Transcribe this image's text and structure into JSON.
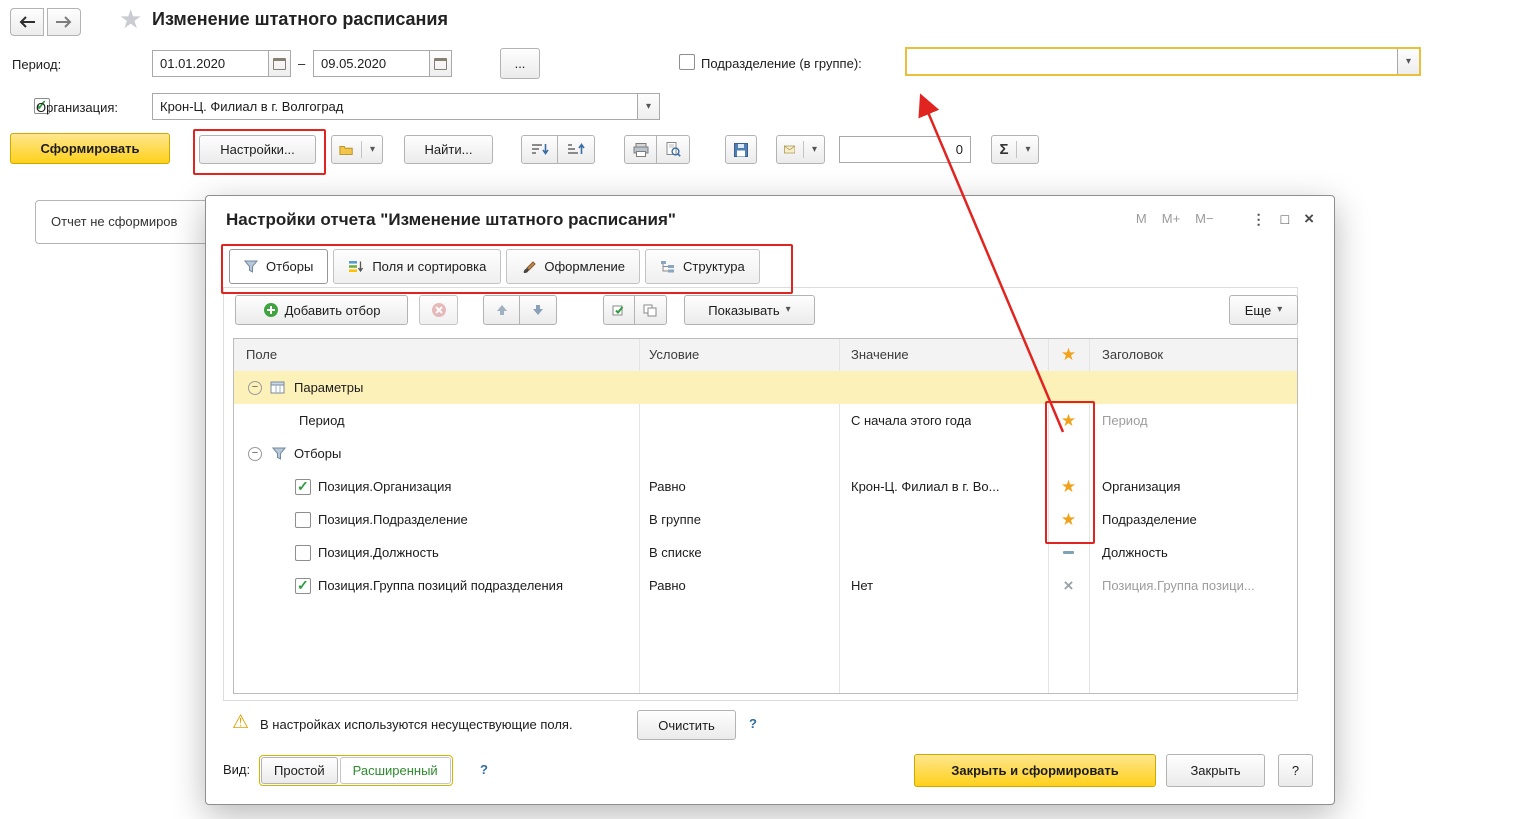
{
  "topbar": {
    "title": "Изменение штатного расписания"
  },
  "filters": {
    "period_label": "Период:",
    "date_from": "01.01.2020",
    "date_to": "09.05.2020",
    "range_dash": "–",
    "ellipsis": "...",
    "department_label": "Подразделение (в группе):",
    "department_value": "",
    "department_checked": false,
    "org_label": "Организация:",
    "org_value": "Крон-Ц. Филиал в г. Волгоград",
    "org_checked": true
  },
  "toolbar": {
    "generate": "Сформировать",
    "settings": "Настройки...",
    "find": "Найти...",
    "count_value": "0",
    "sigma": "Σ"
  },
  "report_area": {
    "status_tab": "Отчет не сформиров"
  },
  "dialog": {
    "title": "Настройки отчета \"Изменение штатного расписания\"",
    "controls": {
      "m": "M",
      "m_plus": "M+",
      "m_minus": "M−"
    },
    "tabs": [
      {
        "label": "Отборы"
      },
      {
        "label": "Поля и сортировка"
      },
      {
        "label": "Оформление"
      },
      {
        "label": "Структура"
      }
    ],
    "toolbar": {
      "add": "Добавить отбор",
      "show": "Показывать",
      "more": "Еще"
    },
    "table": {
      "headers": {
        "field": "Поле",
        "condition": "Условие",
        "value": "Значение",
        "star": "star",
        "title": "Заголовок"
      },
      "rows": [
        {
          "kind": "group",
          "label": "Параметры",
          "selected": true
        },
        {
          "kind": "param",
          "field": "Период",
          "condition": "",
          "value": "С начала этого года",
          "marker": "star",
          "title": "Период"
        },
        {
          "kind": "group",
          "label": "Отборы"
        },
        {
          "kind": "filter",
          "checked": true,
          "field": "Позиция.Организация",
          "condition": "Равно",
          "value": "Крон-Ц. Филиал в г. Во...",
          "marker": "star",
          "title": "Организация"
        },
        {
          "kind": "filter",
          "checked": false,
          "field": "Позиция.Подразделение",
          "condition": "В группе",
          "value": "",
          "marker": "star",
          "title": "Подразделение"
        },
        {
          "kind": "filter",
          "checked": false,
          "field": "Позиция.Должность",
          "condition": "В списке",
          "value": "",
          "marker": "dash",
          "title": "Должность"
        },
        {
          "kind": "filter",
          "checked": true,
          "field": "Позиция.Группа позиций подразделения",
          "condition": "Равно",
          "value": "Нет",
          "marker": "x",
          "title": "Позиция.Группа позици..."
        }
      ]
    },
    "warning": {
      "text": "В настройках используются несуществующие поля.",
      "clear": "Очистить",
      "help": "?"
    },
    "footer": {
      "view_label": "Вид:",
      "simple": "Простой",
      "extended": "Расширенный",
      "help": "?",
      "close_generate": "Закрыть и сформировать",
      "close": "Закрыть",
      "help_button": "?"
    }
  }
}
